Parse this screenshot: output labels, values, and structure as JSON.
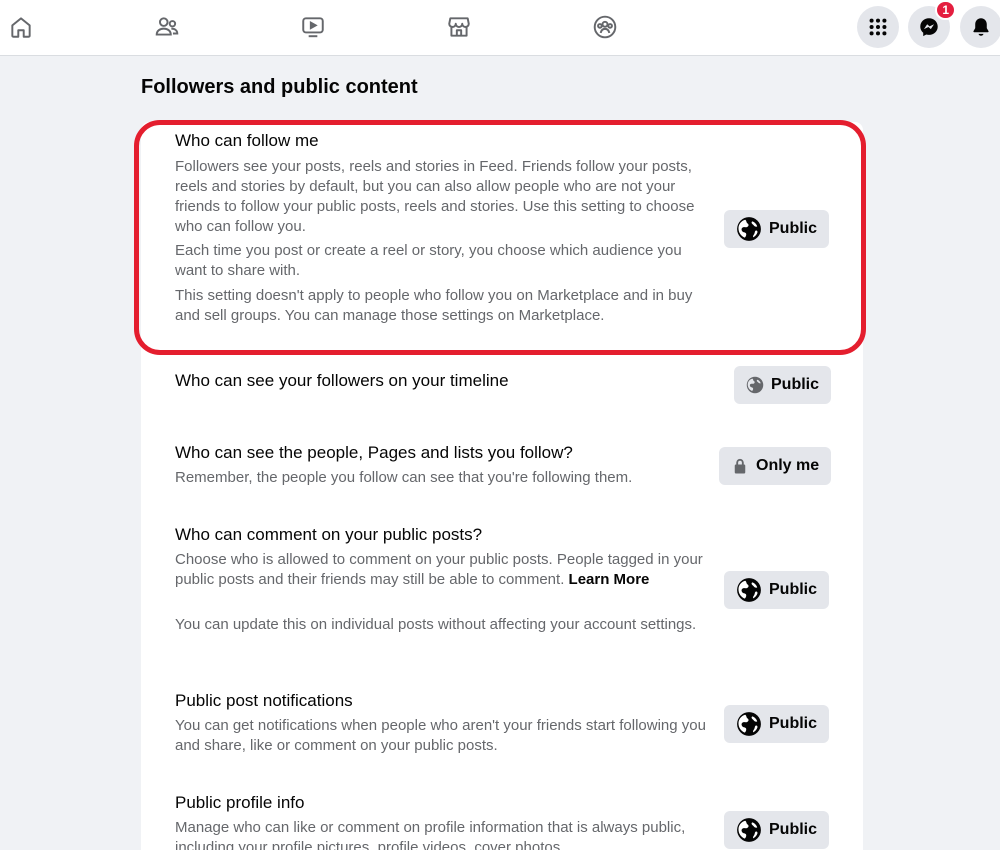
{
  "nav": {
    "icons": [
      "home-icon",
      "friends-icon",
      "video-icon",
      "marketplace-icon",
      "groups-icon"
    ],
    "menu_icon": "grid-menu-icon",
    "messenger_icon": "messenger-icon",
    "messenger_badge": "1",
    "notifications_icon": "bell-icon"
  },
  "section": {
    "title": "Followers and public content"
  },
  "settings": [
    {
      "title": "Who can follow me",
      "desc": [
        "Followers see your posts, reels and stories in Feed. Friends follow your posts, reels and stories by default, but you can also allow people who are not your friends to follow your public posts, reels and stories. Use this setting to choose who can follow you.",
        "Each time you post or create a reel or story, you choose which audience you want to share with.",
        "This setting doesn't apply to people who follow you on Marketplace and in buy and sell groups. You can manage those settings on Marketplace."
      ],
      "button": "Public",
      "button_icon": "globe-icon"
    },
    {
      "title": "Who can see your followers on your timeline",
      "button": "Public",
      "button_icon": "globe-icon"
    },
    {
      "title": "Who can see the people, Pages and lists you follow?",
      "desc": [
        "Remember, the people you follow can see that you're following them."
      ],
      "button": "Only me",
      "button_icon": "lock-icon"
    },
    {
      "title": "Who can comment on your public posts?",
      "desc": [
        "Choose who is allowed to comment on your public posts. People tagged in your public posts and their friends may still be able to comment.",
        "You can update this on individual posts without affecting your account settings."
      ],
      "link": "Learn More",
      "button": "Public",
      "button_icon": "globe-icon"
    },
    {
      "title": "Public post notifications",
      "desc": [
        "You can get notifications when people who aren't your friends start following you and share, like or comment on your public posts."
      ],
      "button": "Public",
      "button_icon": "globe-icon"
    },
    {
      "title": "Public profile info",
      "desc": [
        "Manage who can like or comment on profile information that is always public, including your profile pictures, profile videos, cover photos,"
      ],
      "button": "Public",
      "button_icon": "globe-icon"
    }
  ],
  "colors": {
    "highlight": "#e41e2e",
    "badge": "#e41e3f",
    "pill_bg": "#e4e6eb",
    "secondary_text": "#65676b"
  }
}
